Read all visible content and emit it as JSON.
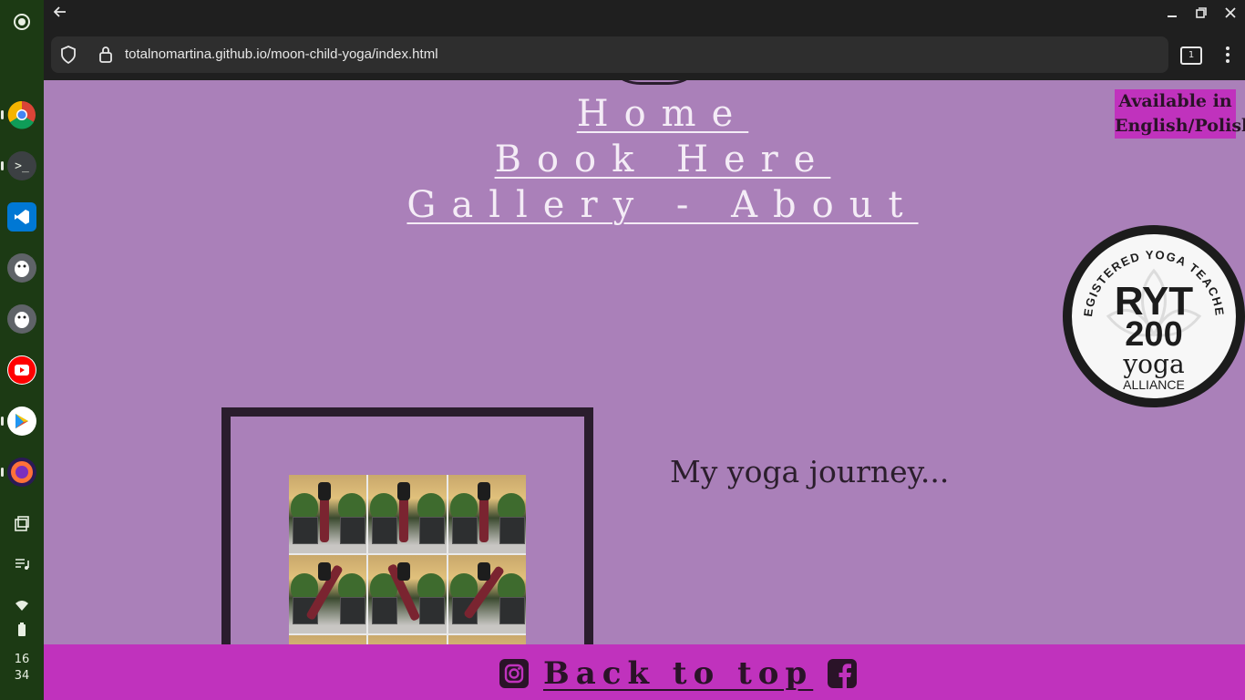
{
  "browser": {
    "url": "totalnomartina.github.io/moon-child-yoga/index.html",
    "tab_count": "1"
  },
  "system": {
    "clock_hour": "16",
    "clock_minute": "34"
  },
  "nav": {
    "home": "Home",
    "book": "Book Here",
    "gallery": "Gallery - About"
  },
  "language_badge": "Available in English/Polish",
  "badge_logo": {
    "ring_text": "REGISTERED YOGA TEACHER",
    "line1": "RYT",
    "line2": "200",
    "line3": "yoga",
    "line4": "ALLIANCE"
  },
  "section": {
    "heading": "My yoga journey..."
  },
  "footer": {
    "back_to_top": "Back to top"
  },
  "colors": {
    "page_bg": "#aa80b9",
    "accent": "#c032bd",
    "text_dark": "#2a1328"
  }
}
